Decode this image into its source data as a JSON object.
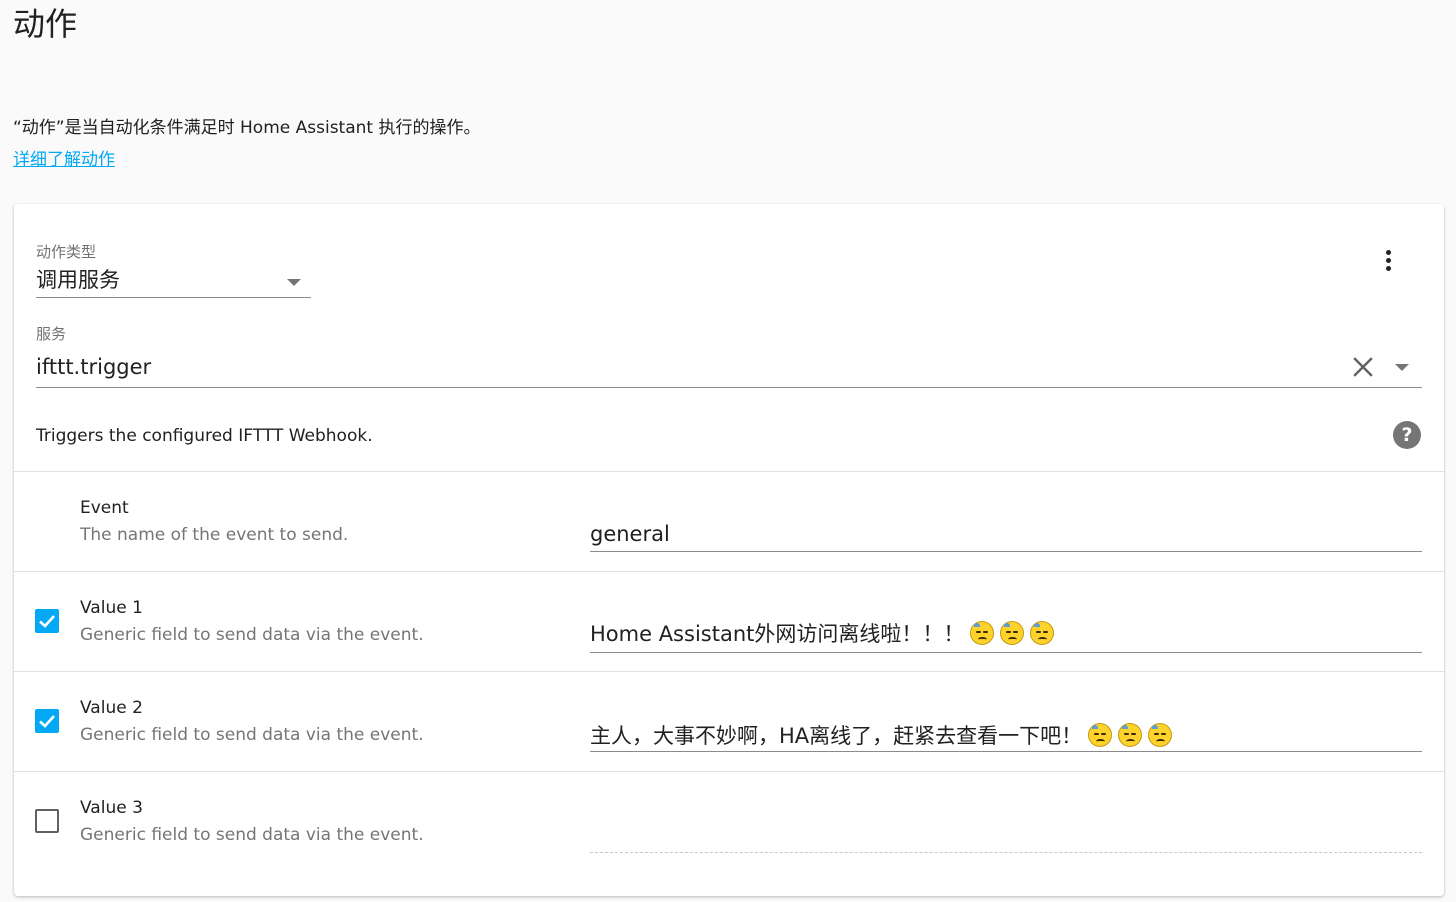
{
  "page": {
    "title": "动作",
    "description": "“动作”是当自动化条件满足时 Home Assistant 执行的操作。",
    "learn_more_link": "详细了解动作"
  },
  "action": {
    "type_label": "动作类型",
    "type_value": "调用服务",
    "service_label": "服务",
    "service_value": "ifttt.trigger",
    "service_description": "Triggers the configured IFTTT Webhook.",
    "help_icon_glyph": "?"
  },
  "fields": [
    {
      "name": "Event",
      "description": "The name of the event to send.",
      "value": "general",
      "checkbox": "none",
      "emoji_count": 0
    },
    {
      "name": "Value 1",
      "description": "Generic field to send data via the event.",
      "value": "Home Assistant外网访问离线啦！！！",
      "checkbox": "checked",
      "emoji_count": 3
    },
    {
      "name": "Value 2",
      "description": "Generic field to send data via the event.",
      "value": "主人，大事不妙啊，HA离线了，赶紧去查看一下吧！",
      "checkbox": "checked",
      "emoji_count": 3
    },
    {
      "name": "Value 3",
      "description": "Generic field to send data via the event.",
      "value": "",
      "checkbox": "unchecked",
      "emoji_count": 0
    }
  ],
  "icons": {
    "menu": "more-vertical-icon",
    "clear": "close-icon",
    "dropdown": "chevron-down-icon",
    "help": "help-circle-icon",
    "checkbox": "check-icon",
    "emoji": "downcast-face-with-sweat-emoji"
  },
  "colors": {
    "accent": "#03a9f4",
    "background": "#fafafa",
    "card": "#ffffff",
    "help_icon": "#757575"
  }
}
